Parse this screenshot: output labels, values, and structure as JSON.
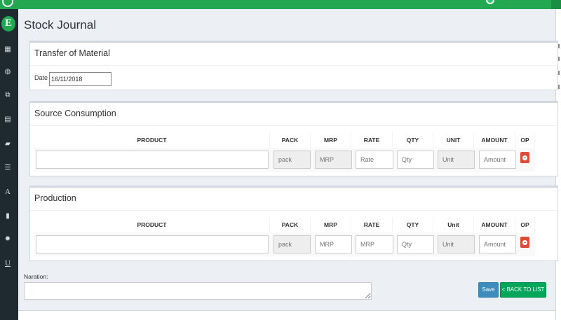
{
  "page": {
    "title": "Stock Journal"
  },
  "transfer": {
    "title": "Transfer of Material",
    "date_label": "Date :",
    "date_value": "16/11/2018"
  },
  "source": {
    "title": "Source Consumption",
    "columns": [
      "PRODUCT",
      "PACK",
      "MRP",
      "RATE",
      "QTY",
      "UNIT",
      "AMOUNT",
      "OP"
    ],
    "row": {
      "product": "",
      "pack": "pack",
      "mrp": "MRP",
      "rate": "Rate",
      "qty": "Qty",
      "unit": "Unit",
      "amount": "Amount"
    }
  },
  "production": {
    "title": "Production",
    "columns": [
      "PRODUCT",
      "PACK",
      "MRP",
      "RATE",
      "QTY",
      "Unit",
      "AMOUNT",
      "OP"
    ],
    "row": {
      "product": "",
      "pack": "pack",
      "mrp": "MRP",
      "rate": "MRP",
      "qty": "Qty",
      "unit": "Unit",
      "amount": "Amount"
    }
  },
  "naration": {
    "label": "Naration:",
    "value": ""
  },
  "buttons": {
    "save": "Save",
    "back": "< BACK TO LIST"
  },
  "sidebar": {
    "brand_letter": "E",
    "icons": [
      "table-icon",
      "globe-icon",
      "copy-icon",
      "file-icon",
      "truck-icon",
      "list-icon",
      "font-a-icon",
      "book-icon",
      "gear-icon",
      "underline-u-icon"
    ]
  },
  "colors": {
    "brand_green": "#21a850",
    "sidebar_bg": "#1f2a30",
    "save_blue": "#3c8dbc",
    "back_green": "#00a65a",
    "delete_red": "#dd4b39"
  }
}
